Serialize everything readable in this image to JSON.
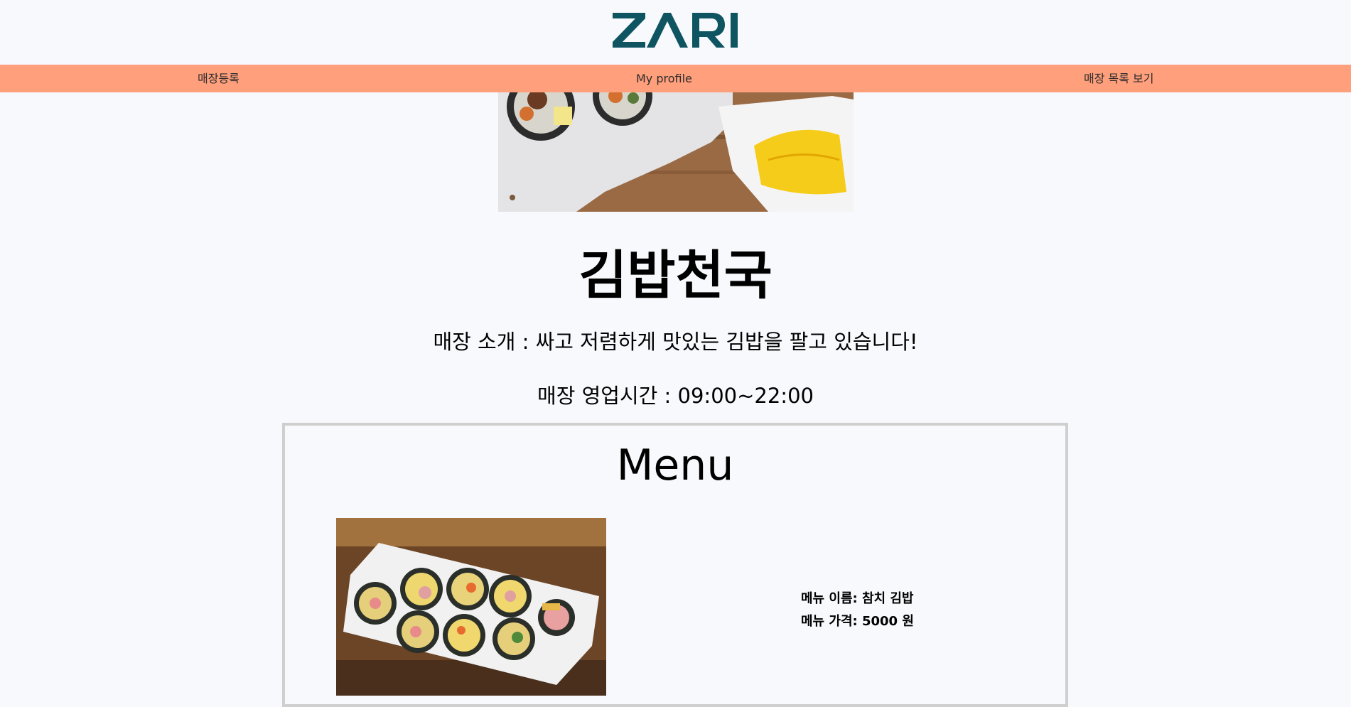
{
  "header": {
    "logo_text": "ZARI",
    "logo_color": "#0e5561"
  },
  "nav": {
    "background": "#ff9f7c",
    "items": [
      {
        "label": "매장등록"
      },
      {
        "label": "My profile"
      },
      {
        "label": "매장 목록 보기"
      }
    ]
  },
  "store": {
    "name": "김밥천국",
    "intro": "매장 소개 : 싸고 저렴하게 맛있는 김밥을 팔고 있습니다!",
    "hours": "매장 영업시간 : 09:00~22:00"
  },
  "menu": {
    "title": "Menu",
    "items": [
      {
        "name_line": "메뉴 이름: 참치 김밥",
        "price_line": "메뉴 가격: 5000 원"
      }
    ]
  }
}
